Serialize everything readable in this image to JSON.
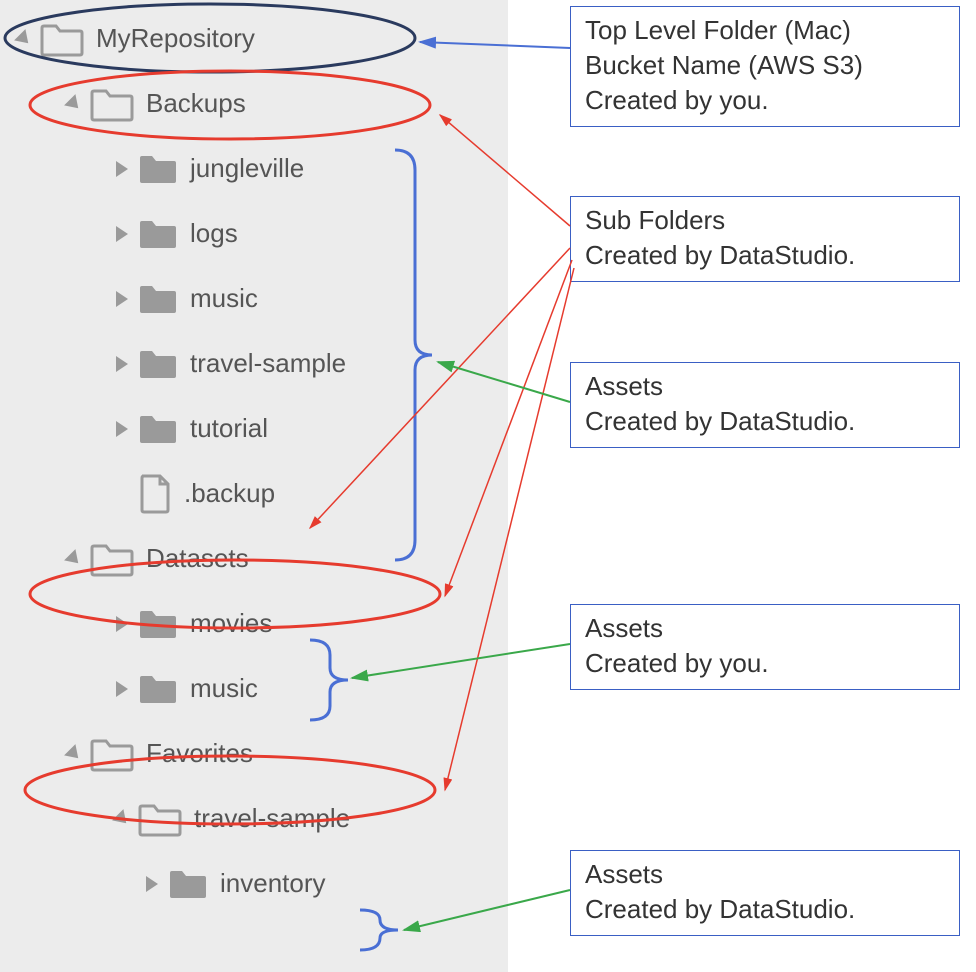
{
  "tree": {
    "root": {
      "label": "MyRepository"
    },
    "backups": {
      "label": "Backups",
      "children": [
        {
          "label": "jungleville"
        },
        {
          "label": "logs"
        },
        {
          "label": "music"
        },
        {
          "label": "travel-sample"
        },
        {
          "label": "tutorial"
        },
        {
          "label": ".backup"
        }
      ]
    },
    "datasets": {
      "label": "Datasets",
      "children": [
        {
          "label": "movies"
        },
        {
          "label": "music"
        }
      ]
    },
    "favorites": {
      "label": "Favorites",
      "children": [
        {
          "label": "travel-sample",
          "children": [
            {
              "label": "inventory"
            }
          ]
        }
      ]
    }
  },
  "callouts": {
    "top": {
      "l1": "Top Level Folder (Mac)",
      "l2": "Bucket Name (AWS S3)",
      "l3": "Created by you."
    },
    "sub": {
      "l1": "Sub Folders",
      "l2": "Created by DataStudio."
    },
    "assets1": {
      "l1": "Assets",
      "l2": "Created by DataStudio."
    },
    "assets2": {
      "l1": "Assets",
      "l2": "Created by you."
    },
    "assets3": {
      "l1": "Assets",
      "l2": "Created by DataStudio."
    }
  },
  "colors": {
    "ovalTop": "#2a3a5e",
    "ovalRed": "#e63b2e",
    "arrowBlue": "#4a6fd4",
    "arrowRed": "#e63b2e",
    "arrowGreen": "#3aa84a",
    "brace": "#4a6fd4"
  }
}
